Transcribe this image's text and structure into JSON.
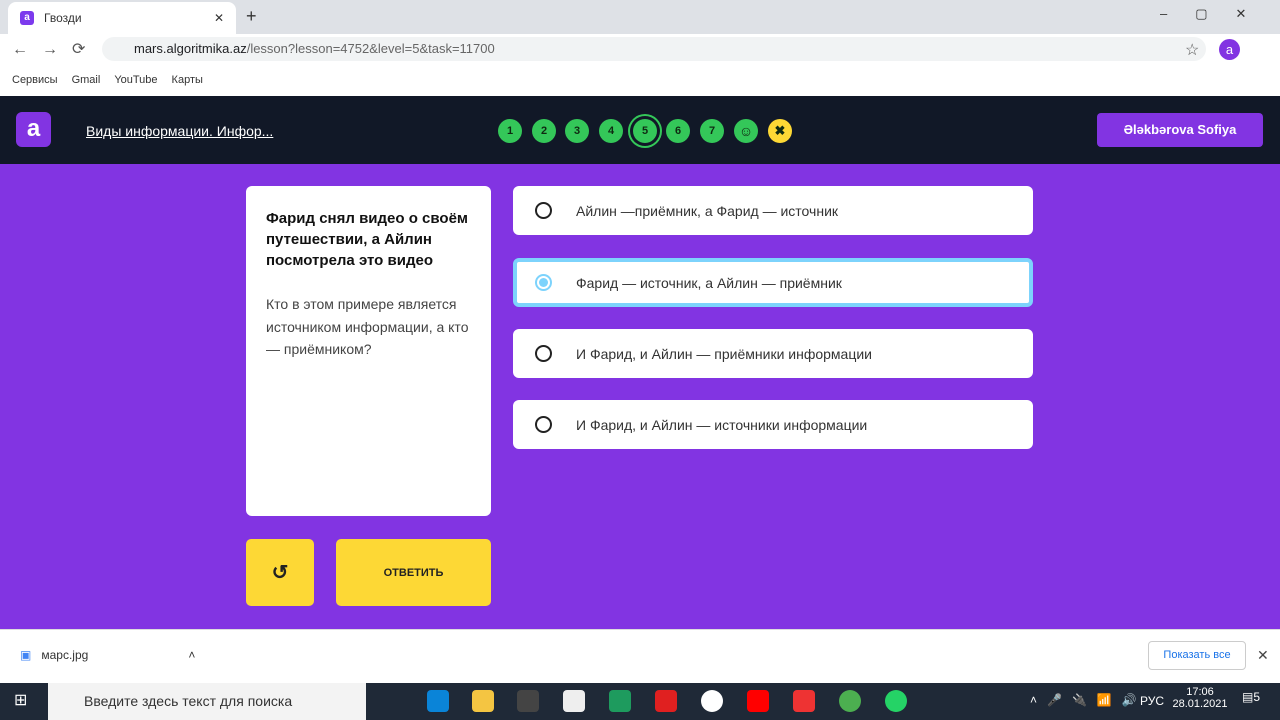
{
  "browser": {
    "tab_title": "Гвозди",
    "url_host": "mars.algoritmika.az",
    "url_path": "/lesson?lesson=4752&level=5&task=11700",
    "bookmarks": [
      "Сервисы",
      "Gmail",
      "YouTube",
      "Карты"
    ]
  },
  "header": {
    "logo": "a",
    "lesson_title": "Виды информации. Инфор...",
    "steps": [
      "1",
      "2",
      "3",
      "4",
      "5",
      "6",
      "7"
    ],
    "current_step": "5",
    "user": "Ələkbərova Sofiya"
  },
  "question": {
    "title": "Фарид снял видео о своём путешествии, а Айлин посмотрела это видео",
    "text": "Кто в этом примере является источником информации, а кто — приёмником?"
  },
  "options": [
    {
      "label": "Айлин —приёмник, а Фарид — источник",
      "selected": false
    },
    {
      "label": "Фарид — источник, а Айлин — приёмник",
      "selected": true
    },
    {
      "label": "И Фарид, и Айлин — приёмники информации",
      "selected": false
    },
    {
      "label": "И Фарид, и Айлин — источники информации",
      "selected": false
    }
  ],
  "buttons": {
    "reset_icon": "undo-icon",
    "answer": "ОТВЕТИТЬ"
  },
  "downloads": {
    "file": "марс.jpg",
    "show_all": "Показать все"
  },
  "taskbar": {
    "search_placeholder": "Введите здесь текст для поиска",
    "lang": "РУС",
    "time": "17:06",
    "date": "28.01.2021",
    "notifications": "5"
  },
  "colors": {
    "accent": "#8234e2",
    "header": "#111827",
    "success": "#34c759",
    "button": "#fdd835",
    "selected": "#7dd3fc"
  }
}
